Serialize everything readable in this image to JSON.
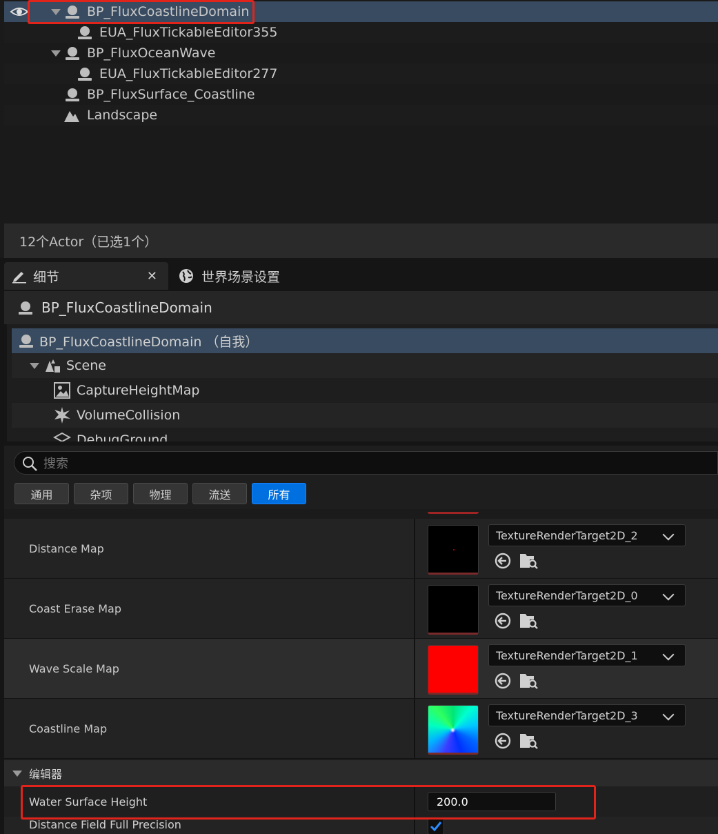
{
  "outliner": {
    "items": [
      {
        "label": "BP_FluxCoastlineDomain",
        "type": "actor",
        "expanded": true,
        "selected": true,
        "level": 0
      },
      {
        "label": "EUA_FluxTickableEditor355",
        "type": "actor",
        "level": 1
      },
      {
        "label": "BP_FluxOceanWave",
        "type": "actor",
        "expanded": true,
        "level": 0
      },
      {
        "label": "EUA_FluxTickableEditor277",
        "type": "actor",
        "level": 1
      },
      {
        "label": "BP_FluxSurface_Coastline",
        "type": "actor",
        "level": 0
      },
      {
        "label": "Landscape",
        "type": "landscape",
        "level": 0
      }
    ],
    "footer": "12个Actor（已选1个）"
  },
  "details": {
    "tabs": [
      {
        "label": "细节",
        "icon": "pencil-icon",
        "active": true
      },
      {
        "label": "世界场景设置",
        "icon": "globe-icon",
        "active": false
      }
    ],
    "actor_name": "BP_FluxCoastlineDomain",
    "components": [
      {
        "label": "BP_FluxCoastlineDomain （自我）",
        "icon": "actor-icon",
        "selected": true
      },
      {
        "label": "Scene",
        "icon": "scene-icon"
      },
      {
        "label": "CaptureHeightMap",
        "icon": "capture-icon"
      },
      {
        "label": "VolumeCollision",
        "icon": "collision-icon"
      },
      {
        "label": "DebugGround",
        "icon": "mesh-icon"
      }
    ],
    "search_placeholder": "搜索",
    "filters": [
      "通用",
      "杂项",
      "物理",
      "流送",
      "所有"
    ],
    "active_filter": "所有",
    "texture_props": [
      {
        "name": "Distance Map",
        "asset": "TextureRenderTarget2D_2"
      },
      {
        "name": "Coast Erase Map",
        "asset": "TextureRenderTarget2D_0"
      },
      {
        "name": "Wave Scale Map",
        "asset": "TextureRenderTarget2D_1"
      },
      {
        "name": "Coastline Map",
        "asset": "TextureRenderTarget2D_3"
      }
    ],
    "editor_category": "编辑器",
    "water_surface_height": {
      "name": "Water Surface Height",
      "value": "200.0"
    },
    "distance_field_full_precision": {
      "name": "Distance Field Full Precision",
      "checked": true
    }
  },
  "colors": {
    "accent": "#0070e0",
    "selection": "#394b60",
    "highlight": "#e0231b"
  }
}
